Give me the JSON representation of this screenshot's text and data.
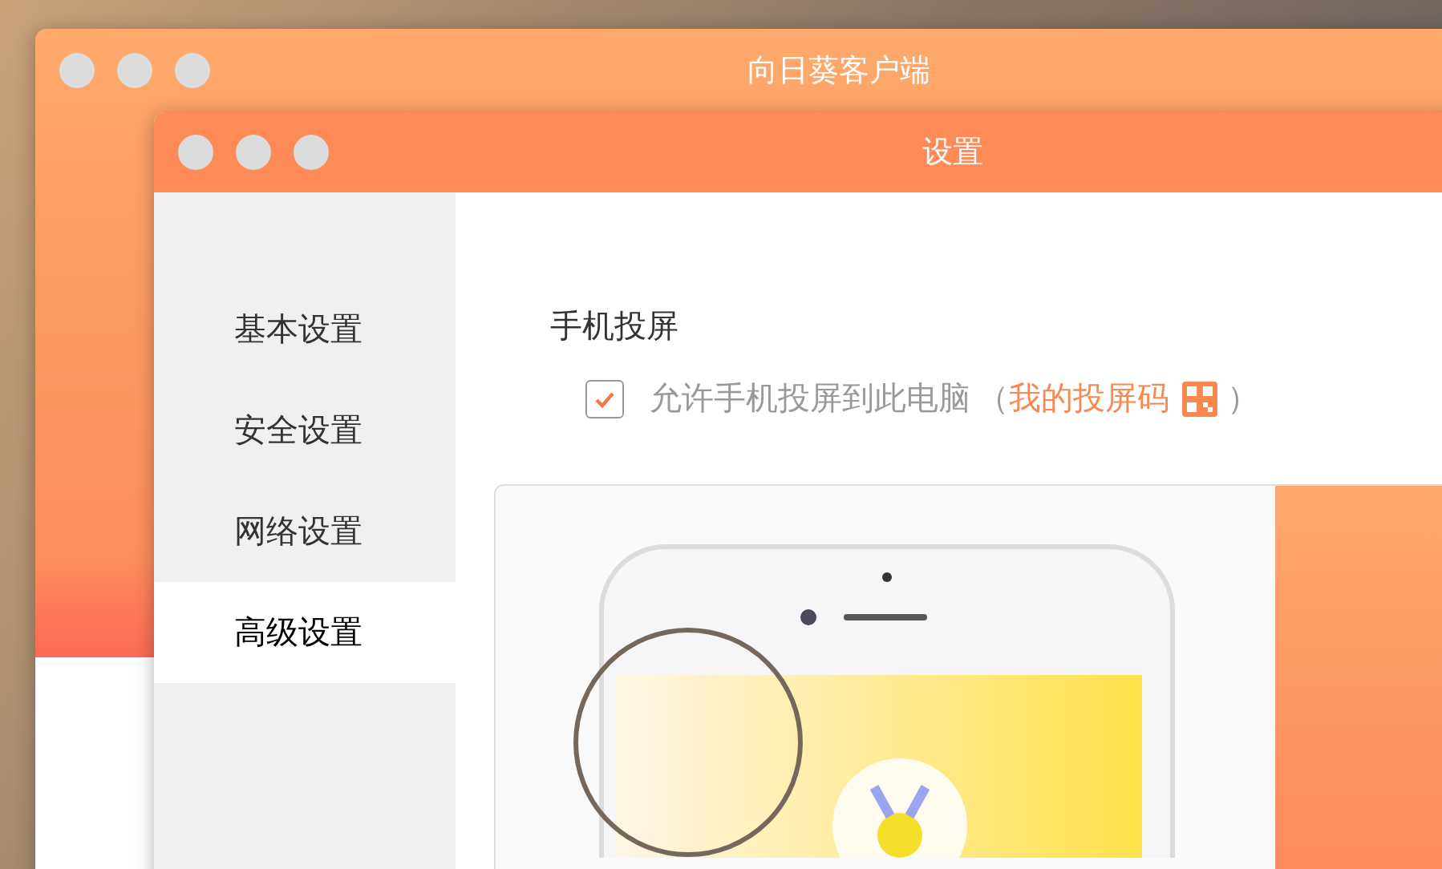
{
  "main_window": {
    "title": "向日葵客户端"
  },
  "settings_window": {
    "title": "设置"
  },
  "sidebar": {
    "items": [
      {
        "label": "基本设置",
        "selected": false
      },
      {
        "label": "安全设置",
        "selected": false
      },
      {
        "label": "网络设置",
        "selected": false
      },
      {
        "label": "高级设置",
        "selected": true
      }
    ]
  },
  "section": {
    "title": "手机投屏",
    "option": {
      "label": "允许手机投屏到此电脑",
      "checked": true,
      "open_paren": "（",
      "link": "我的投屏码",
      "close_paren": "）"
    }
  }
}
